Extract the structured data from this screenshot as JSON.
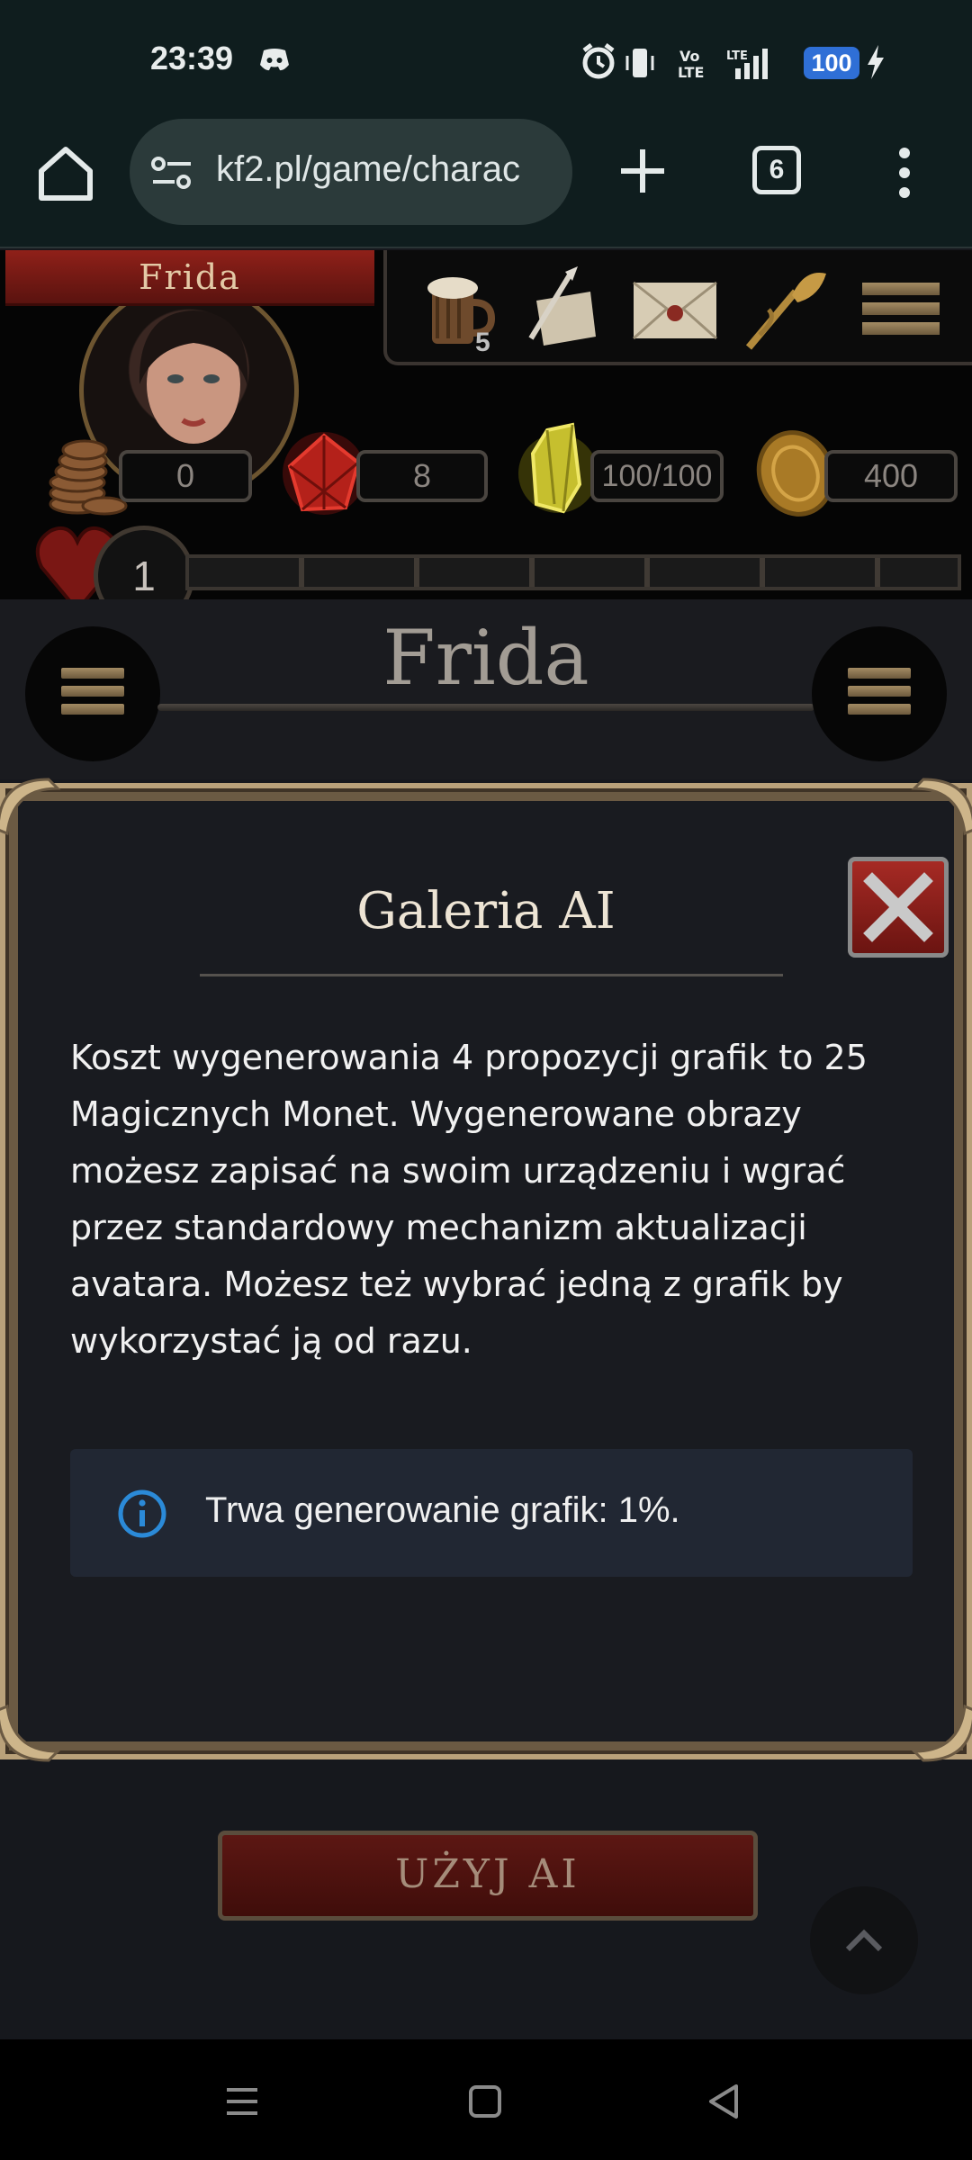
{
  "status_bar": {
    "time": "23:39",
    "battery": "100",
    "icons": [
      "discord-icon",
      "alarm-icon",
      "vibrate-icon",
      "volte-icon",
      "lte-signal-icon",
      "charging-icon"
    ]
  },
  "browser": {
    "url": "kf2.pl/game/charac",
    "tab_count": "6"
  },
  "game": {
    "character_name": "Frida",
    "toolbar_badge": "5",
    "resources": {
      "coins": "0",
      "crystals": "8",
      "energy": "100/100",
      "gold_coins": "400"
    },
    "level": "1",
    "page_title": "Frida"
  },
  "dialog": {
    "title": "Galeria AI",
    "body": "Koszt wygenerowania 4 propozycji grafik to 25 Magicznych Monet. Wygenerowane obrazy możesz zapisać na swoim urządzeniu i wgrać przez standardowy mechanizm aktualizacji avatara. Możesz też wybrać jedną z grafik by wykorzystać ją od razu.",
    "alert": "Trwa generowanie grafik: 1%."
  },
  "page": {
    "peek_text": "fab",
    "use_ai_button": "UŻYJ AI"
  },
  "colors": {
    "accent_red": "#8f2019",
    "info_blue": "#2b8ad8",
    "battery_blue": "#2f6fd6"
  }
}
